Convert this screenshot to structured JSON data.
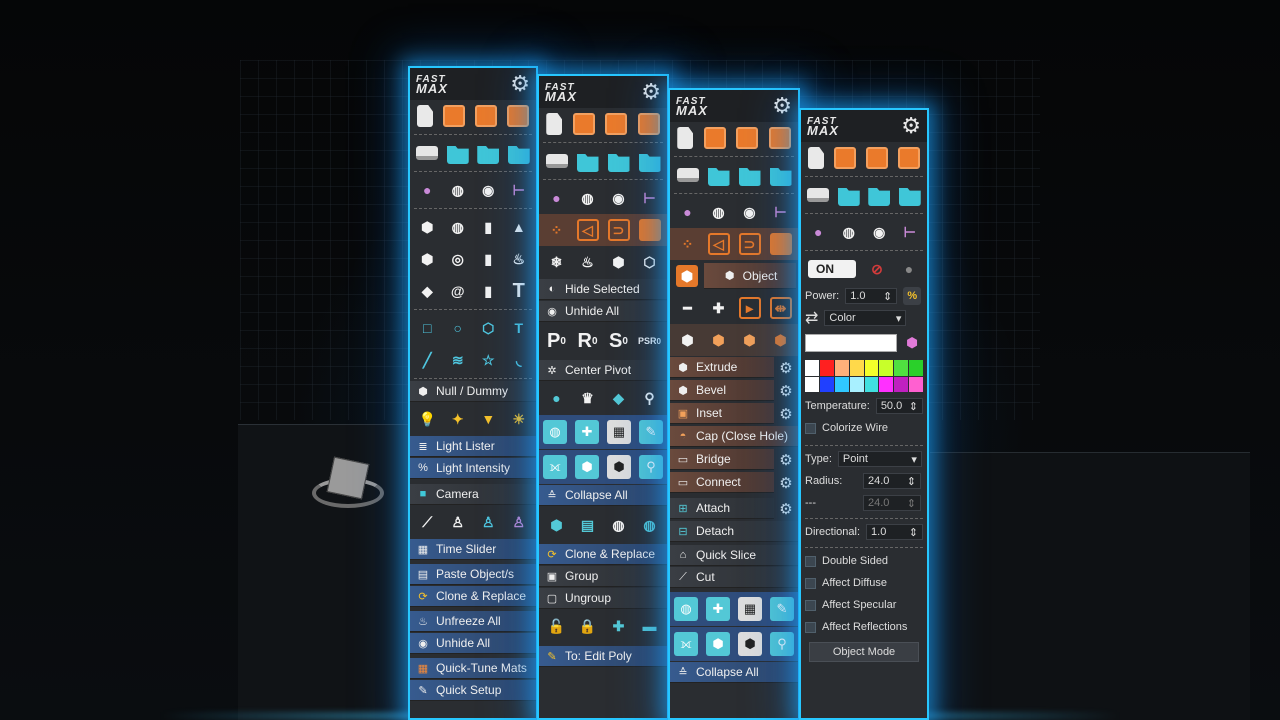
{
  "brand": {
    "line1": "FAST",
    "line2": "MAX"
  },
  "icons": {
    "gear": "gear-icon",
    "file_row": [
      "new-file-icon",
      "save-icon",
      "save-as-icon",
      "save-incremental-icon"
    ],
    "io_row": [
      "import-icon",
      "open-folder-icon",
      "merge-folder-icon",
      "recent-folder-icon"
    ]
  },
  "panel1": {
    "buttons": {
      "null_dummy": "Null / Dummy",
      "light_lister": "Light Lister",
      "light_intensity": "Light Intensity",
      "camera": "Camera",
      "time_slider": "Time Slider",
      "paste_objects": "Paste Object/s",
      "clone_replace": "Clone & Replace",
      "unfreeze_all": "Unfreeze All",
      "unhide_all": "Unhide All",
      "quick_tune_mats": "Quick-Tune Mats",
      "quick_setup": "Quick Setup"
    },
    "text_tool_glyph": "T",
    "text_shape_glyph": "T"
  },
  "panel2": {
    "buttons": {
      "hide_selected": "Hide Selected",
      "unhide_all": "Unhide All",
      "center_pivot": "Center Pivot",
      "collapse_all": "Collapse All",
      "clone_replace": "Clone & Replace",
      "group": "Group",
      "ungroup": "Ungroup",
      "to_edit_poly": "To: Edit Poly"
    },
    "transform_glyphs": [
      "P",
      "R",
      "S",
      "PSR"
    ],
    "transform_subscripts": [
      "0",
      "0",
      "0",
      "0"
    ]
  },
  "panel3": {
    "buttons": {
      "object": "Object",
      "extrude": "Extrude",
      "bevel": "Bevel",
      "inset": "Inset",
      "cap": "Cap (Close Hole)",
      "bridge": "Bridge",
      "connect": "Connect",
      "attach": "Attach",
      "detach": "Detach",
      "quick_slice": "Quick Slice",
      "cut": "Cut",
      "collapse_all": "Collapse All"
    }
  },
  "panel4": {
    "toggle": "ON",
    "power_label": "Power:",
    "power_value": "1.0",
    "color_mode": "Color",
    "temperature_label": "Temperature:",
    "temperature_value": "50.0",
    "colorize_wire": "Colorize Wire",
    "type_label": "Type:",
    "type_value": "Point",
    "radius_label": "Radius:",
    "radius_value": "24.0",
    "radius2_label": "---",
    "radius2_value": "24.0",
    "directional_label": "Directional:",
    "directional_value": "1.0",
    "double_sided": "Double Sided",
    "affect_diffuse": "Affect Diffuse",
    "affect_specular": "Affect Specular",
    "affect_reflections": "Affect Reflections",
    "object_mode": "Object Mode",
    "palette": [
      "#ffffff",
      "#ff2020",
      "#ffb07a",
      "#ffd94a",
      "#f4ff2a",
      "#c8ff2a",
      "#50e040",
      "#2ad02a",
      "#ffffff",
      "#2040ff",
      "#30c8ff",
      "#a8f0ff",
      "#40e0e0",
      "#ff30ff",
      "#c020c0",
      "#ff60d0"
    ]
  }
}
